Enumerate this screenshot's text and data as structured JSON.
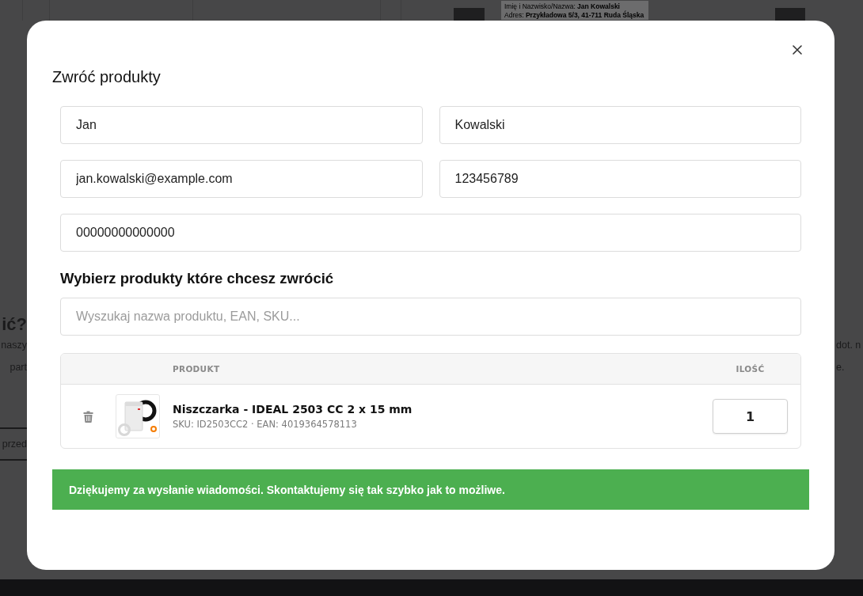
{
  "background_page": {
    "document_lines": [
      "Imię i Nazwisko/Nazwa: **Jan Kowalski**",
      "Adres: **Przykładowa 5/3, 41-711 Ruda Śląska**"
    ],
    "left_fragments": [
      {
        "kind": "heading",
        "text": "ić?"
      },
      {
        "kind": "text",
        "text": "naszy"
      },
      {
        "kind": "text",
        "text": "part"
      }
    ],
    "left_button": "przed",
    "right_fragments": [
      "dot. n",
      "e."
    ]
  },
  "dialog": {
    "title": "Zwróć produkty",
    "field_rows": [
      {
        "fields": [
          {
            "value": "Jan"
          },
          {
            "value": "Kowalski"
          }
        ]
      },
      {
        "fields": [
          {
            "value": "jan.kowalski@example.com"
          },
          {
            "value": "123456789"
          }
        ]
      },
      {
        "fields": [
          {
            "value": "00000000000000"
          }
        ]
      }
    ],
    "section_title": "Wybierz produkty które chcesz zwrócić",
    "search": {
      "placeholder": "Wyszukaj nazwa produktu, EAN, SKU..."
    },
    "table": {
      "columns": [
        "PRODUKT",
        "ILOŚĆ"
      ],
      "rows": [
        {
          "name": "Niszczarka - IDEAL 2503 CC 2 x 15 mm",
          "meta": "SKU: ID2503CC2 · EAN: 4019364578113",
          "quantity": "1"
        }
      ]
    },
    "success_message": "Dziękujemy za wysłanie wiadomości. Skontaktujemy się tak szybko jak to możliwe."
  }
}
